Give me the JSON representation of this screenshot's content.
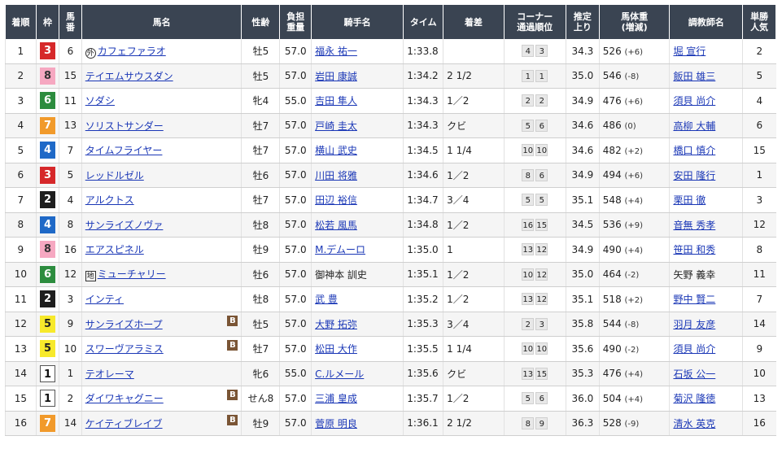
{
  "headers": [
    {
      "label": "着順"
    },
    {
      "label": "枠"
    },
    {
      "label": "馬\n番"
    },
    {
      "label": "馬名"
    },
    {
      "label": "性齢"
    },
    {
      "label": "負担\n重量"
    },
    {
      "label": "騎手名"
    },
    {
      "label": "タイム"
    },
    {
      "label": "着差"
    },
    {
      "label": "コーナー\n通過順位"
    },
    {
      "label": "推定\n上り"
    },
    {
      "label": "馬体重\n(増減)"
    },
    {
      "label": "調教師名"
    },
    {
      "label": "単勝\n人気"
    }
  ],
  "rows": [
    {
      "rank": "1",
      "waku": "3",
      "num": "6",
      "mark": "外",
      "horse": "カフェファラオ",
      "blinker": "",
      "sexage": "牡5",
      "weight": "57.0",
      "jockey": "福永 祐一",
      "time": "1:33.8",
      "margin": "",
      "corner": [
        "4",
        "3"
      ],
      "agari": "34.3",
      "bw": "526",
      "bwd": "(+6)",
      "trainer": "堀 宣行",
      "trainer_link": true,
      "pop": "2"
    },
    {
      "rank": "2",
      "waku": "8",
      "num": "15",
      "mark": "",
      "horse": "テイエムサウスダン",
      "blinker": "",
      "sexage": "牡5",
      "weight": "57.0",
      "jockey": "岩田 康誠",
      "time": "1:34.2",
      "margin": "2 1/2",
      "corner": [
        "1",
        "1"
      ],
      "agari": "35.0",
      "bw": "546",
      "bwd": "(-8)",
      "trainer": "飯田 雄三",
      "trainer_link": true,
      "pop": "5"
    },
    {
      "rank": "3",
      "waku": "6",
      "num": "11",
      "mark": "",
      "horse": "ソダシ",
      "blinker": "",
      "sexage": "牝4",
      "weight": "55.0",
      "jockey": "吉田 隼人",
      "time": "1:34.3",
      "margin": "1／2",
      "corner": [
        "2",
        "2"
      ],
      "agari": "34.9",
      "bw": "476",
      "bwd": "(+6)",
      "trainer": "須貝 尚介",
      "trainer_link": true,
      "pop": "4"
    },
    {
      "rank": "4",
      "waku": "7",
      "num": "13",
      "mark": "",
      "horse": "ソリストサンダー",
      "blinker": "",
      "sexage": "牡7",
      "weight": "57.0",
      "jockey": "戸崎 圭太",
      "time": "1:34.3",
      "margin": "クビ",
      "corner": [
        "5",
        "6"
      ],
      "agari": "34.6",
      "bw": "486",
      "bwd": "(0)",
      "trainer": "高柳 大輔",
      "trainer_link": true,
      "pop": "6"
    },
    {
      "rank": "5",
      "waku": "4",
      "num": "7",
      "mark": "",
      "horse": "タイムフライヤー",
      "blinker": "",
      "sexage": "牡7",
      "weight": "57.0",
      "jockey": "横山 武史",
      "time": "1:34.5",
      "margin": "1 1/4",
      "corner": [
        "10",
        "10"
      ],
      "agari": "34.6",
      "bw": "482",
      "bwd": "(+2)",
      "trainer": "橋口 慎介",
      "trainer_link": true,
      "pop": "15"
    },
    {
      "rank": "6",
      "waku": "3",
      "num": "5",
      "mark": "",
      "horse": "レッドルゼル",
      "blinker": "",
      "sexage": "牡6",
      "weight": "57.0",
      "jockey": "川田 将雅",
      "time": "1:34.6",
      "margin": "1／2",
      "corner": [
        "8",
        "6"
      ],
      "agari": "34.9",
      "bw": "494",
      "bwd": "(+6)",
      "trainer": "安田 隆行",
      "trainer_link": true,
      "pop": "1"
    },
    {
      "rank": "7",
      "waku": "2",
      "num": "4",
      "mark": "",
      "horse": "アルクトス",
      "blinker": "",
      "sexage": "牡7",
      "weight": "57.0",
      "jockey": "田辺 裕信",
      "time": "1:34.7",
      "margin": "3／4",
      "corner": [
        "5",
        "5"
      ],
      "agari": "35.1",
      "bw": "548",
      "bwd": "(+4)",
      "trainer": "栗田 徹",
      "trainer_link": true,
      "pop": "3"
    },
    {
      "rank": "8",
      "waku": "4",
      "num": "8",
      "mark": "",
      "horse": "サンライズノヴァ",
      "blinker": "",
      "sexage": "牡8",
      "weight": "57.0",
      "jockey": "松若 風馬",
      "time": "1:34.8",
      "margin": "1／2",
      "corner": [
        "16",
        "15"
      ],
      "agari": "34.5",
      "bw": "536",
      "bwd": "(+9)",
      "trainer": "音無 秀孝",
      "trainer_link": true,
      "pop": "12"
    },
    {
      "rank": "9",
      "waku": "8",
      "num": "16",
      "mark": "",
      "horse": "エアスピネル",
      "blinker": "",
      "sexage": "牡9",
      "weight": "57.0",
      "jockey": "M.デムーロ",
      "time": "1:35.0",
      "margin": "1",
      "corner": [
        "13",
        "12"
      ],
      "agari": "34.9",
      "bw": "490",
      "bwd": "(+4)",
      "trainer": "笹田 和秀",
      "trainer_link": true,
      "pop": "8"
    },
    {
      "rank": "10",
      "waku": "6",
      "num": "12",
      "mark": "地",
      "horse": "ミューチャリー",
      "blinker": "",
      "sexage": "牡6",
      "weight": "57.0",
      "jockey": "御神本 訓史",
      "jockey_link": false,
      "time": "1:35.1",
      "margin": "1／2",
      "corner": [
        "10",
        "12"
      ],
      "agari": "35.0",
      "bw": "464",
      "bwd": "(-2)",
      "trainer": "矢野 義幸",
      "trainer_link": false,
      "pop": "11"
    },
    {
      "rank": "11",
      "waku": "2",
      "num": "3",
      "mark": "",
      "horse": "インティ",
      "blinker": "",
      "sexage": "牡8",
      "weight": "57.0",
      "jockey": "武 豊",
      "time": "1:35.2",
      "margin": "1／2",
      "corner": [
        "13",
        "12"
      ],
      "agari": "35.1",
      "bw": "518",
      "bwd": "(+2)",
      "trainer": "野中 賢二",
      "trainer_link": true,
      "pop": "7"
    },
    {
      "rank": "12",
      "waku": "5",
      "num": "9",
      "mark": "",
      "horse": "サンライズホープ",
      "blinker": "B",
      "sexage": "牡5",
      "weight": "57.0",
      "jockey": "大野 拓弥",
      "time": "1:35.3",
      "margin": "3／4",
      "corner": [
        "2",
        "3"
      ],
      "agari": "35.8",
      "bw": "544",
      "bwd": "(-8)",
      "trainer": "羽月 友彦",
      "trainer_link": true,
      "pop": "14"
    },
    {
      "rank": "13",
      "waku": "5",
      "num": "10",
      "mark": "",
      "horse": "スワーヴアラミス",
      "blinker": "B",
      "sexage": "牡7",
      "weight": "57.0",
      "jockey": "松田 大作",
      "time": "1:35.5",
      "margin": "1 1/4",
      "corner": [
        "10",
        "10"
      ],
      "agari": "35.6",
      "bw": "490",
      "bwd": "(-2)",
      "trainer": "須貝 尚介",
      "trainer_link": true,
      "pop": "9"
    },
    {
      "rank": "14",
      "waku": "1",
      "num": "1",
      "mark": "",
      "horse": "テオレーマ",
      "blinker": "",
      "sexage": "牝6",
      "weight": "55.0",
      "jockey": "C.ルメール",
      "time": "1:35.6",
      "margin": "クビ",
      "corner": [
        "13",
        "15"
      ],
      "agari": "35.3",
      "bw": "476",
      "bwd": "(+4)",
      "trainer": "石坂 公一",
      "trainer_link": true,
      "pop": "10"
    },
    {
      "rank": "15",
      "waku": "1",
      "num": "2",
      "mark": "",
      "horse": "ダイワキャグニー",
      "blinker": "B",
      "sexage": "せん8",
      "weight": "57.0",
      "jockey": "三浦 皇成",
      "time": "1:35.7",
      "margin": "1／2",
      "corner": [
        "5",
        "6"
      ],
      "agari": "36.0",
      "bw": "504",
      "bwd": "(+4)",
      "trainer": "菊沢 隆徳",
      "trainer_link": true,
      "pop": "13"
    },
    {
      "rank": "16",
      "waku": "7",
      "num": "14",
      "mark": "",
      "horse": "ケイティブレイブ",
      "blinker": "B",
      "sexage": "牡9",
      "weight": "57.0",
      "jockey": "菅原 明良",
      "time": "1:36.1",
      "margin": "2 1/2",
      "corner": [
        "8",
        "9"
      ],
      "agari": "36.3",
      "bw": "528",
      "bwd": "(-9)",
      "trainer": "清水 英克",
      "trainer_link": true,
      "pop": "16"
    }
  ]
}
